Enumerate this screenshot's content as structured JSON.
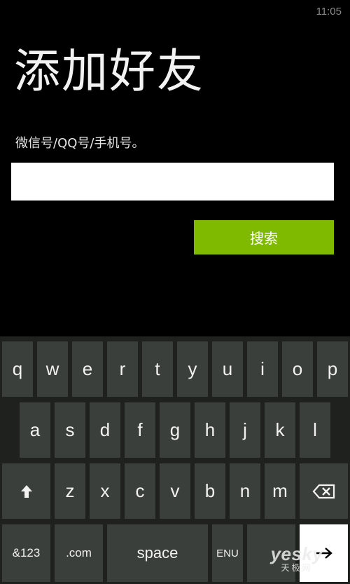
{
  "status_bar": {
    "time": "11:05"
  },
  "page": {
    "title": "添加好友",
    "field_label": "微信号/QQ号/手机号。",
    "input_value": "",
    "search_button": "搜索"
  },
  "keyboard": {
    "row1": [
      "q",
      "w",
      "e",
      "r",
      "t",
      "y",
      "u",
      "i",
      "o",
      "p"
    ],
    "row2": [
      "a",
      "s",
      "d",
      "f",
      "g",
      "h",
      "j",
      "k",
      "l"
    ],
    "row3": [
      "z",
      "x",
      "c",
      "v",
      "b",
      "n",
      "m"
    ],
    "symbols_label": "&123",
    "dotcom_label": ".com",
    "space_label": "space",
    "lang_label": "ENU",
    "icons": {
      "shift": "shift-arrow-icon",
      "backspace": "backspace-icon",
      "enter": "enter-arrow-icon"
    }
  },
  "watermark": {
    "brand": "yesky",
    "sub": "天极网"
  },
  "colors": {
    "accent": "#7fba00",
    "key": "#3b3f3c",
    "keyboard_bg": "#1e211e",
    "background": "#000000"
  }
}
